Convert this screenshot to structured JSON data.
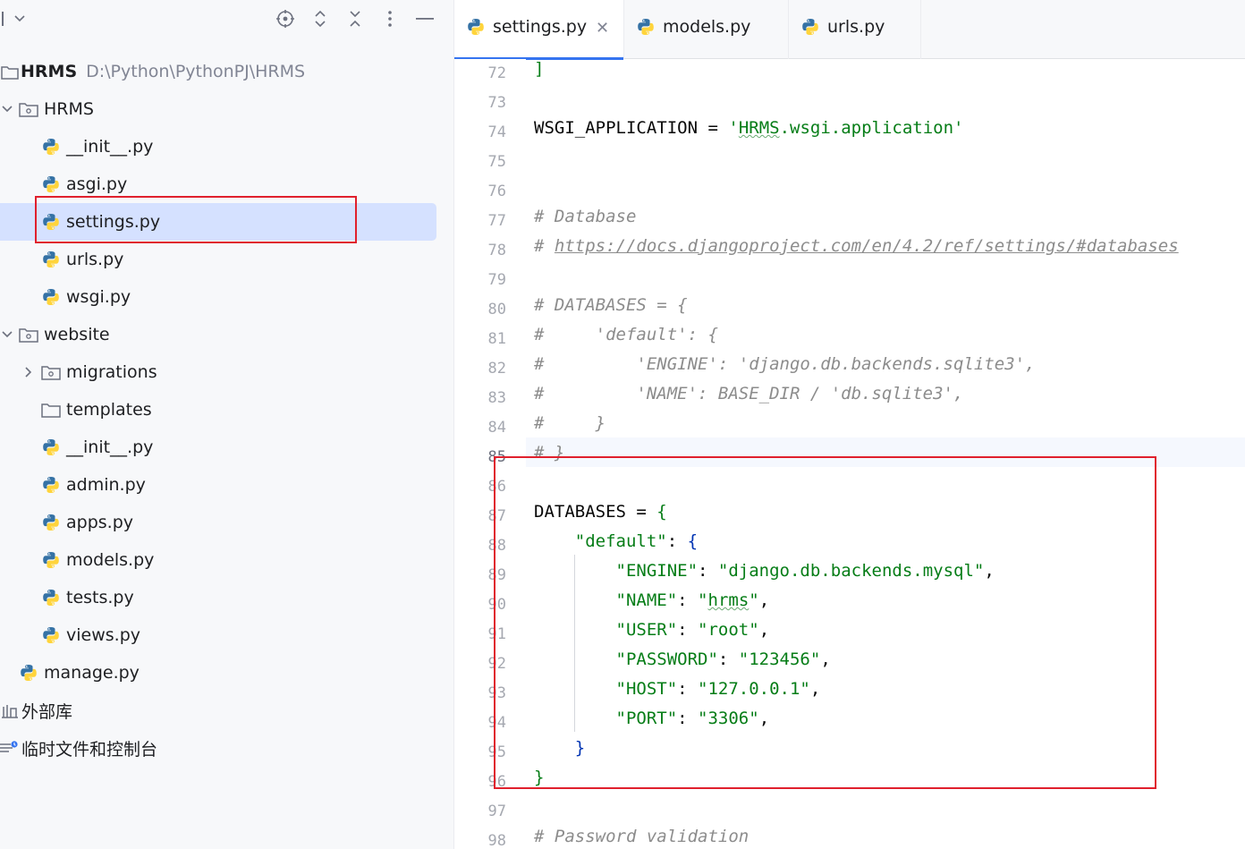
{
  "project": {
    "root_name": "HRMS",
    "root_path": "D:\\Python\\PythonPJ\\HRMS",
    "packages": [
      {
        "name": "HRMS",
        "files": [
          "__init__.py",
          "asgi.py",
          "settings.py",
          "urls.py",
          "wsgi.py"
        ]
      },
      {
        "name": "website",
        "folders": [
          "migrations",
          "templates"
        ],
        "files": [
          "__init__.py",
          "admin.py",
          "apps.py",
          "models.py",
          "tests.py",
          "views.py"
        ]
      }
    ],
    "root_files": [
      "manage.py"
    ],
    "external_libraries": "外部库",
    "scratches": "临时文件和控制台",
    "selected_file": "settings.py"
  },
  "tabs": [
    {
      "label": "settings.py",
      "active": true
    },
    {
      "label": "models.py",
      "active": false
    },
    {
      "label": "urls.py",
      "active": false
    }
  ],
  "editor": {
    "line_numbers": [
      "72",
      "73",
      "74",
      "75",
      "76",
      "77",
      "78",
      "79",
      "80",
      "81",
      "82",
      "83",
      "84",
      "85",
      "86",
      "87",
      "88",
      "89",
      "90",
      "91",
      "92",
      "93",
      "94",
      "95",
      "96",
      "97",
      "98"
    ],
    "current_line": "85",
    "code": {
      "l72": "]",
      "l74_name": "WSGI_APPLICATION",
      "l74_eq": " = ",
      "l74_q1": "'",
      "l74_mod": "HRMS",
      "l74_rest": ".wsgi.application'",
      "l77": "# Database",
      "l78_hash": "# ",
      "l78_url": "https://docs.djangoproject.com/en/4.2/ref/settings/#databases",
      "l80": "# DATABASES = {",
      "l81": "#     'default': {",
      "l82": "#         'ENGINE': 'django.db.backends.sqlite3',",
      "l83": "#         'NAME': BASE_DIR / 'db.sqlite3',",
      "l84": "#     }",
      "l85": "# }",
      "l87_name": "DATABASES",
      "l87_eq": " = ",
      "l87_brace": "{",
      "l88_key": "\"default\"",
      "l88_colon": ": ",
      "l88_brace": "{",
      "l89_key": "\"ENGINE\"",
      "l89_val": "\"django.db.backends.mysql\"",
      "l90_key": "\"NAME\"",
      "l90_q1": "\"",
      "l90_val": "hrms",
      "l90_q2": "\"",
      "l91_key": "\"USER\"",
      "l91_val": "\"root\"",
      "l92_key": "\"PASSWORD\"",
      "l92_val": "\"123456\"",
      "l93_key": "\"HOST\"",
      "l93_val": "\"127.0.0.1\"",
      "l94_key": "\"PORT\"",
      "l94_val": "\"3306\"",
      "colon": ": ",
      "comma": ",",
      "l95": "}",
      "l96": "}",
      "l98": "# Password validation"
    }
  },
  "colors": {
    "selection": "#d5e1ff",
    "highlight_box": "#e0202d",
    "tab_underline": "#3574f0",
    "string_green": "#067d17",
    "comment_gray": "#8c8c8c"
  }
}
